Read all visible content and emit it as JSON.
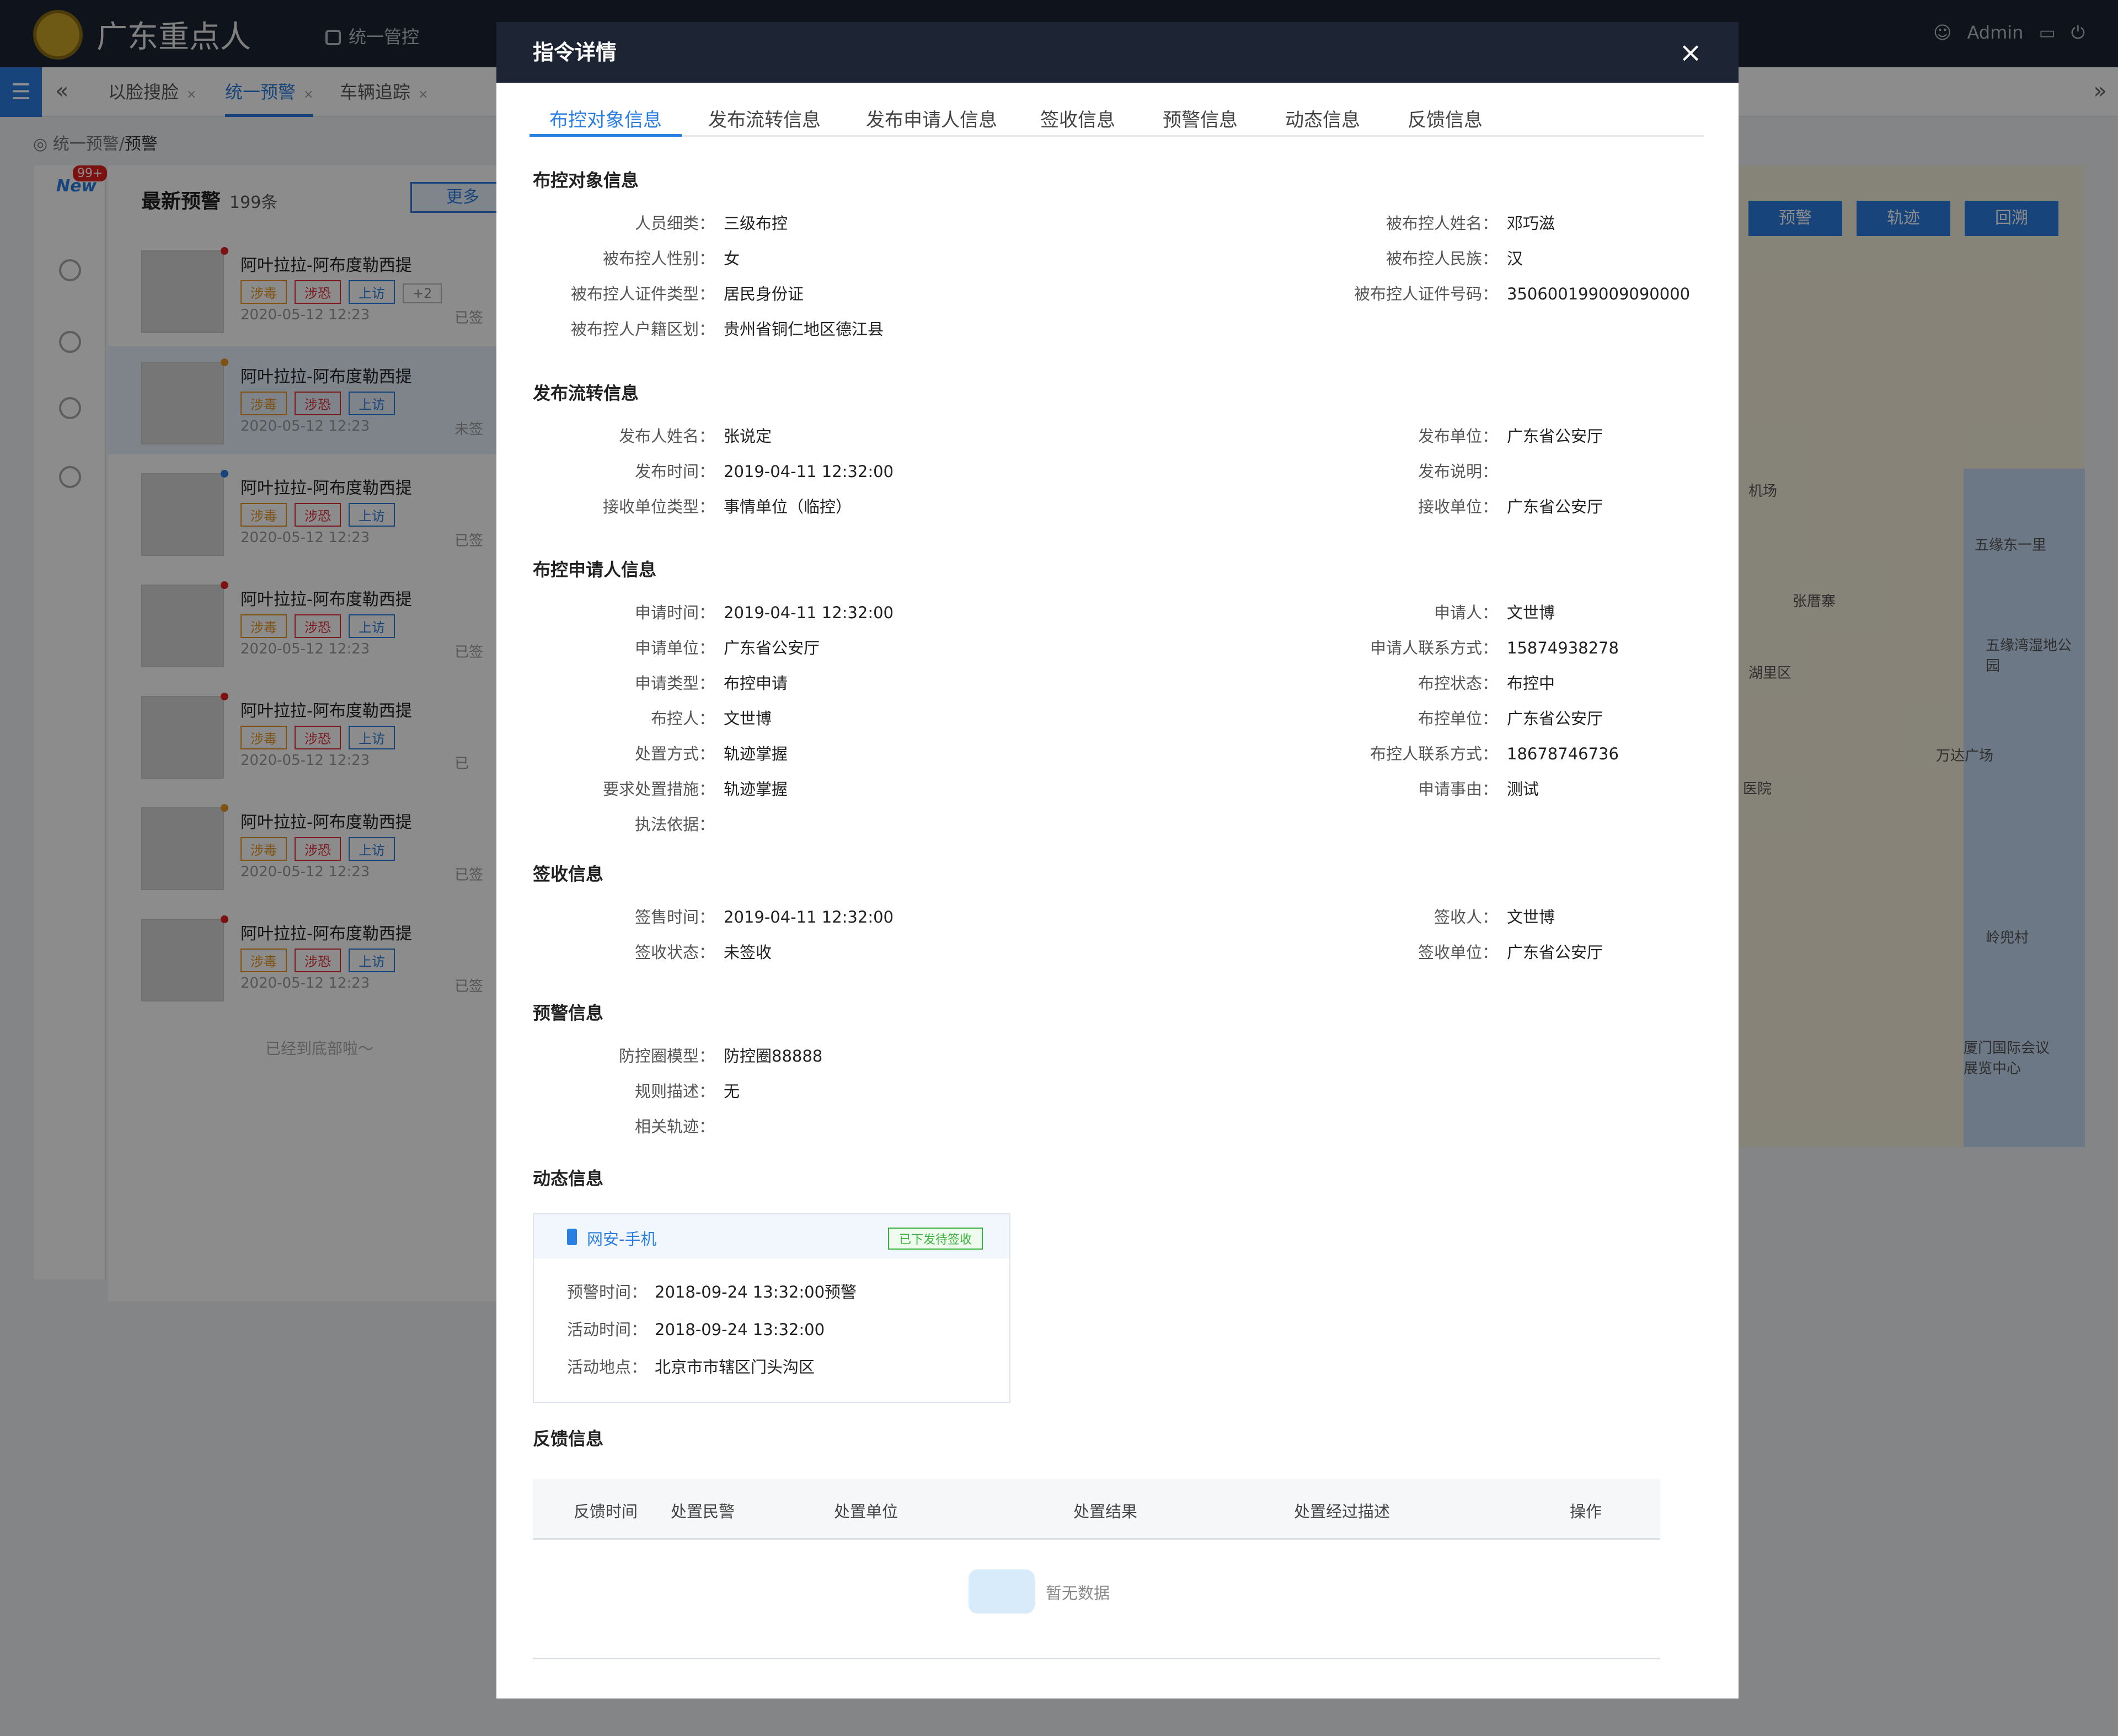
{
  "app": {
    "title": "广东重点人",
    "nav": [
      "统一管控"
    ],
    "user": "Admin"
  },
  "tabs": {
    "items": [
      {
        "label": "以脸搜脸",
        "close": "×"
      },
      {
        "label": "统一预警",
        "close": "×"
      },
      {
        "label": "车辆追踪",
        "close": "×"
      }
    ]
  },
  "breadcrumb": {
    "parent": "统一预警/",
    "current": "预警"
  },
  "sidebar": {
    "new_badge": "99+",
    "new_label": "New"
  },
  "alerts": {
    "title": "最新预警",
    "count": "199条",
    "more": "更多",
    "items": [
      {
        "name": "阿叶拉拉-阿布度勒西提",
        "tags": [
          "涉毒",
          "涉恐",
          "上访"
        ],
        "extra": "+2",
        "time": "2020-05-12  12:23",
        "status": "已签",
        "dot": "#e02020"
      },
      {
        "name": "阿叶拉拉-阿布度勒西提",
        "tags": [
          "涉毒",
          "涉恐",
          "上访"
        ],
        "time": "2020-05-12  12:23",
        "status": "未签",
        "dot": "#e59623"
      },
      {
        "name": "阿叶拉拉-阿布度勒西提",
        "tags": [
          "涉毒",
          "涉恐",
          "上访"
        ],
        "time": "2020-05-12  12:23",
        "status": "已签",
        "dot": "#2b7fe0"
      },
      {
        "name": "阿叶拉拉-阿布度勒西提",
        "tags": [
          "涉毒",
          "涉恐",
          "上访"
        ],
        "time": "2020-05-12  12:23",
        "status": "已签",
        "dot": "#e02020"
      },
      {
        "name": "阿叶拉拉-阿布度勒西提",
        "tags": [
          "涉毒",
          "涉恐",
          "上访"
        ],
        "time": "2020-05-12  12:23",
        "status": "已",
        "dot": "#e02020"
      },
      {
        "name": "阿叶拉拉-阿布度勒西提",
        "tags": [
          "涉毒",
          "涉恐",
          "上访"
        ],
        "time": "2020-05-12  12:23",
        "status": "已签",
        "dot": "#e59623"
      },
      {
        "name": "阿叶拉拉-阿布度勒西提",
        "tags": [
          "涉毒",
          "涉恐",
          "上访"
        ],
        "time": "2020-05-12  12:23",
        "status": "已签",
        "dot": "#e02020"
      }
    ],
    "bottom_tip": "已经到底部啦～"
  },
  "map": {
    "buttons": [
      "预警",
      "轨迹",
      "回溯"
    ],
    "labels": [
      "机场",
      "五缘东一里",
      "张厝寨",
      "湖里区",
      "五缘湾湿地公园",
      "万达广场",
      "医院",
      "岭兜村",
      "厦门国际会议展览中心"
    ]
  },
  "modal": {
    "title": "指令详情",
    "close": "×",
    "tabs": [
      "布控对象信息",
      "发布流转信息",
      "发布申请人信息",
      "签收信息",
      "预警信息",
      "动态信息",
      "反馈信息"
    ],
    "sections": {
      "target": {
        "title": "布控对象信息",
        "left": [
          {
            "label": "人员细类：",
            "value": "三级布控"
          },
          {
            "label": "被布控人性别：",
            "value": "女"
          },
          {
            "label": "被布控人证件类型：",
            "value": "居民身份证"
          },
          {
            "label": "被布控人户籍区划：",
            "value": "贵州省铜仁地区德江县"
          }
        ],
        "right": [
          {
            "label": "被布控人姓名：",
            "value": "邓巧滋"
          },
          {
            "label": "被布控人民族：",
            "value": "汉"
          },
          {
            "label": "被布控人证件号码：",
            "value": "350600199009090000"
          }
        ]
      },
      "publish": {
        "title": "发布流转信息",
        "left": [
          {
            "label": "发布人姓名：",
            "value": "张说定"
          },
          {
            "label": "发布时间：",
            "value": "2019-04-11 12:32:00"
          },
          {
            "label": "接收单位类型：",
            "value": "事情单位（临控）"
          }
        ],
        "right": [
          {
            "label": "发布单位：",
            "value": "广东省公安厅"
          },
          {
            "label": "发布说明：",
            "value": ""
          },
          {
            "label": "接收单位：",
            "value": "广东省公安厅"
          }
        ]
      },
      "applicant": {
        "title": "布控申请人信息",
        "left": [
          {
            "label": "申请时间：",
            "value": "2019-04-11 12:32:00"
          },
          {
            "label": "申请单位：",
            "value": "广东省公安厅"
          },
          {
            "label": "申请类型：",
            "value": "布控申请"
          },
          {
            "label": "布控人：",
            "value": "文世博"
          },
          {
            "label": "处置方式：",
            "value": "轨迹掌握"
          },
          {
            "label": "要求处置措施：",
            "value": "轨迹掌握"
          },
          {
            "label": "执法依据：",
            "value": ""
          }
        ],
        "right": [
          {
            "label": "申请人：",
            "value": "文世博"
          },
          {
            "label": "申请人联系方式：",
            "value": "15874938278"
          },
          {
            "label": "布控状态：",
            "value": "布控中"
          },
          {
            "label": "布控单位：",
            "value": "广东省公安厅"
          },
          {
            "label": "布控人联系方式：",
            "value": "18678746736"
          },
          {
            "label": "申请事由：",
            "value": "测试"
          }
        ]
      },
      "sign": {
        "title": "签收信息",
        "left": [
          {
            "label": "签售时间：",
            "value": "2019-04-11 12:32:00"
          },
          {
            "label": "签收状态：",
            "value": "未签收"
          }
        ],
        "right": [
          {
            "label": "签收人：",
            "value": "文世博"
          },
          {
            "label": "签收单位：",
            "value": "广东省公安厅"
          }
        ]
      },
      "warning": {
        "title": "预警信息",
        "left": [
          {
            "label": "防控圈模型：",
            "value": "防控圈88888"
          },
          {
            "label": "规则描述：",
            "value": "无"
          },
          {
            "label": "相关轨迹：",
            "value": ""
          }
        ]
      },
      "dynamic": {
        "title": "动态信息",
        "card": {
          "title": "网安-手机",
          "badge": "已下发待签收",
          "rows": [
            {
              "label": "预警时间：",
              "value": "2018-09-24 13:32:00预警"
            },
            {
              "label": "活动时间：",
              "value": "2018-09-24 13:32:00"
            },
            {
              "label": "活动地点：",
              "value": "北京市市辖区门头沟区"
            }
          ]
        }
      },
      "feedback": {
        "title": "反馈信息",
        "columns": [
          "反馈时间",
          "处置民警",
          "处置单位",
          "处置结果",
          "处置经过描述",
          "操作"
        ],
        "empty": "暂无数据"
      }
    }
  }
}
